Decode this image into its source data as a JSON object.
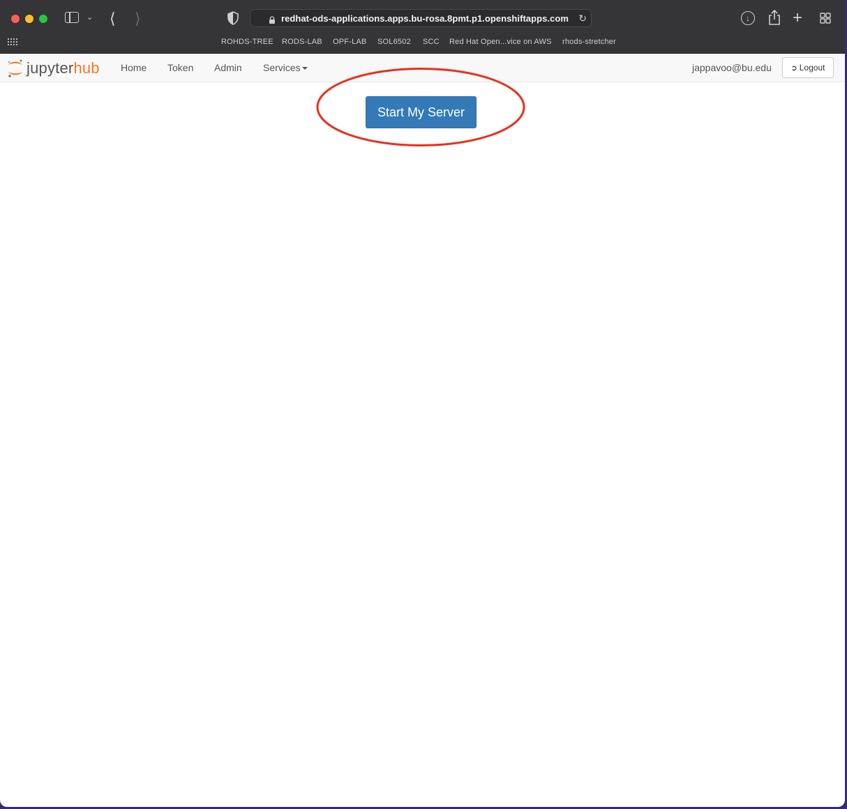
{
  "browser": {
    "url": "redhat-ods-applications.apps.bu-rosa.8pmt.p1.openshiftapps.com",
    "bookmarks": [
      "ROHDS-TREE",
      "RODS-LAB",
      "OPF-LAB",
      "SOL6502",
      "SCC",
      "Red Hat Open...vice on AWS",
      "rhods-stretcher"
    ]
  },
  "navbar": {
    "logo_part1": "jupyter",
    "logo_part2": "hub",
    "links": {
      "home": "Home",
      "token": "Token",
      "admin": "Admin",
      "services": "Services"
    },
    "user": "jappavoo@bu.edu",
    "logout": "Logout"
  },
  "main": {
    "start_button": "Start My Server"
  },
  "colors": {
    "accent": "#f37726",
    "primary_button": "#337ab7",
    "annotation": "#e8301c"
  }
}
